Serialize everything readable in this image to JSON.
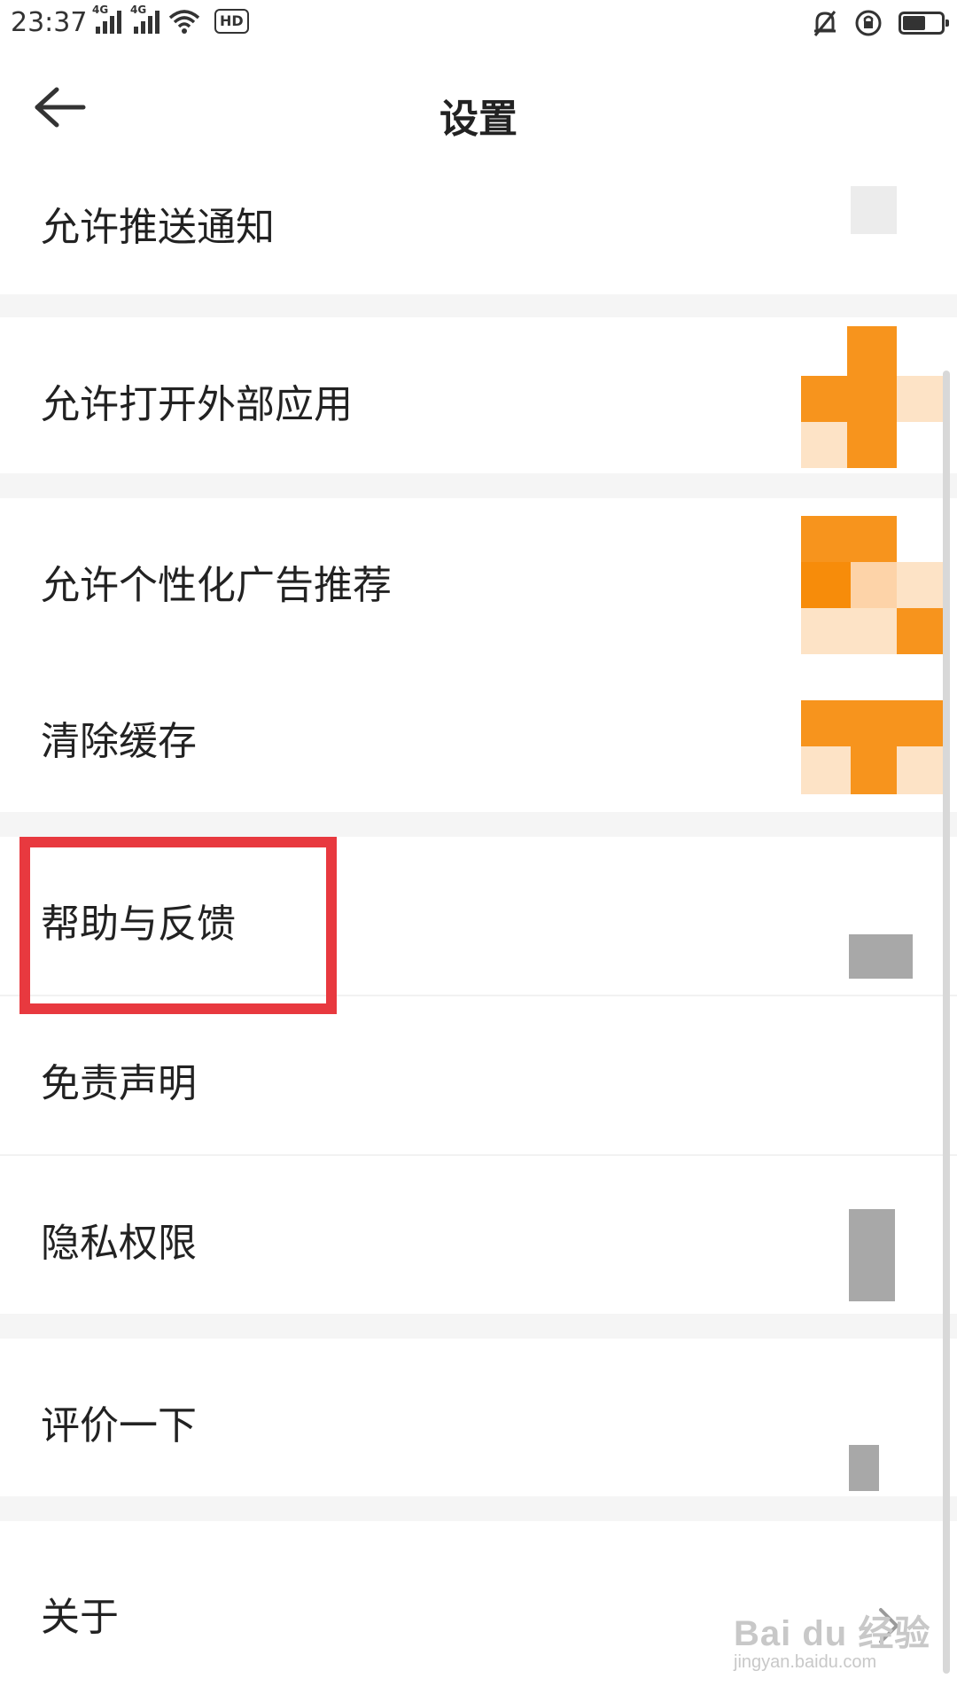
{
  "status_bar": {
    "time": "23:37",
    "signal1_label": "4G",
    "signal2_label": "4G",
    "hd_label": "HD"
  },
  "header": {
    "title": "设置",
    "back_icon": "arrow-left-icon"
  },
  "settings": {
    "items": [
      {
        "label": "允许推送通知"
      },
      {
        "label": "允许打开外部应用"
      },
      {
        "label": "允许个性化广告推荐"
      },
      {
        "label": "清除缓存"
      },
      {
        "label": "帮助与反馈"
      },
      {
        "label": "免责声明"
      },
      {
        "label": "隐私权限"
      },
      {
        "label": "评价一下"
      },
      {
        "label": "关于"
      }
    ]
  },
  "watermark": {
    "main": "Bai du 经验",
    "sub": "jingyan.baidu.com"
  },
  "colors": {
    "accent_orange": "#f7941d",
    "highlight_red": "#e8393f",
    "background": "#ffffff",
    "gap": "#f5f5f5"
  }
}
